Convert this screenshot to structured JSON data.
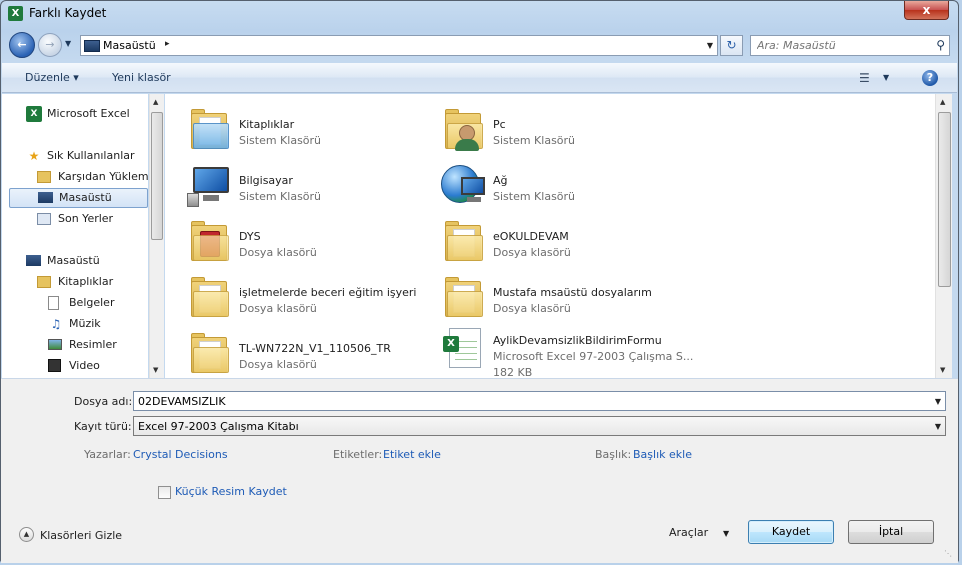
{
  "window": {
    "title": "Farklı Kaydet",
    "app_icon": "X",
    "close_glyph": "x"
  },
  "nav": {
    "address_location": "Masaüstü",
    "address_separator": "▸",
    "search_placeholder": "Ara: Masaüstü"
  },
  "commandbar": {
    "organize_label": "Düzenle ▾",
    "new_folder_label": "Yeni klasör",
    "help_glyph": "?"
  },
  "sidebar": {
    "items": [
      {
        "label": "Microsoft Excel",
        "icon": "excel-icon"
      },
      {
        "label": "Sık Kullanılanlar",
        "icon": "star-icon"
      },
      {
        "label": "Karşıdan Yüklem",
        "icon": "downloads-folder-icon"
      },
      {
        "label": "Masaüstü",
        "icon": "desktop-icon"
      },
      {
        "label": "Son Yerler",
        "icon": "recent-places-icon"
      },
      {
        "label": "Masaüstü",
        "icon": "desktop-icon"
      },
      {
        "label": "Kitaplıklar",
        "icon": "libraries-icon"
      },
      {
        "label": "Belgeler",
        "icon": "documents-icon"
      },
      {
        "label": "Müzik",
        "icon": "music-icon"
      },
      {
        "label": "Resimler",
        "icon": "pictures-icon"
      },
      {
        "label": "Video",
        "icon": "video-icon"
      }
    ]
  },
  "files": [
    {
      "name": "Kitaplıklar",
      "type": "Sistem Klasörü",
      "icon": "libraries-icon"
    },
    {
      "name": "Pc",
      "type": "Sistem Klasörü",
      "icon": "user-folder-icon"
    },
    {
      "name": "Bilgisayar",
      "type": "Sistem Klasörü",
      "icon": "computer-icon"
    },
    {
      "name": "Ağ",
      "type": "Sistem Klasörü",
      "icon": "network-icon"
    },
    {
      "name": "DYS",
      "type": "Dosya klasörü",
      "icon": "folder-icon"
    },
    {
      "name": "eOKULDEVAM",
      "type": "Dosya klasörü",
      "icon": "folder-icon"
    },
    {
      "name": "işletmelerde beceri eğitim işyeri",
      "type": "Dosya klasörü",
      "icon": "folder-icon"
    },
    {
      "name": "Mustafa msaüstü dosyalarım",
      "type": "Dosya klasörü",
      "icon": "folder-icon"
    },
    {
      "name": "TL-WN722N_V1_110506_TR",
      "type": "Dosya klasörü",
      "icon": "folder-icon"
    },
    {
      "name": "AylikDevamsizlikBildirimFormu",
      "type": "Microsoft Excel 97-2003 Çalışma S...",
      "size": "182 KB",
      "icon": "excel-file-icon"
    }
  ],
  "form": {
    "filename_label": "Dosya adı:",
    "filename_value": "02DEVAMSIZLIK",
    "filetype_label": "Kayıt türü:",
    "filetype_value": "Excel 97-2003 Çalışma Kitabı",
    "authors_label": "Yazarlar:",
    "authors_value": "Crystal Decisions",
    "tags_label": "Etiketler:",
    "tags_value": "Etiket ekle",
    "title_label": "Başlık:",
    "title_value": "Başlık ekle",
    "thumbnail_label": "Küçük Resim Kaydet",
    "thumbnail_checked": false
  },
  "footer": {
    "hide_folders_label": "Klasörleri Gizle",
    "tools_label": "Araçlar",
    "save_label": "Kaydet",
    "cancel_label": "İptal"
  },
  "colors": {
    "accent": "#1e5bb6",
    "window_frame": "#c4d9ef",
    "selection": "#d3e3f6"
  }
}
